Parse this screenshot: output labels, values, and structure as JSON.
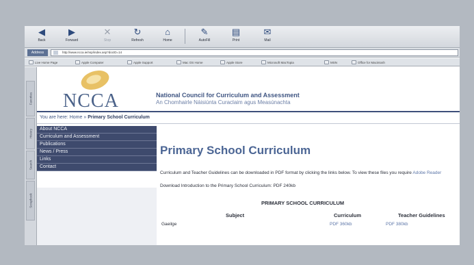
{
  "toolbar": {
    "buttons": [
      {
        "label": "Back",
        "icon": "back-arrow-icon",
        "glyph": "◀"
      },
      {
        "label": "Forward",
        "icon": "forward-arrow-icon",
        "glyph": "▶"
      },
      {
        "label": "Stop",
        "icon": "stop-icon",
        "glyph": "✕"
      },
      {
        "label": "Refresh",
        "icon": "refresh-icon",
        "glyph": "↻"
      },
      {
        "label": "Home",
        "icon": "home-icon",
        "glyph": "⌂"
      },
      {
        "label": "AutoFill",
        "icon": "autofill-icon",
        "glyph": "✎"
      },
      {
        "label": "Print",
        "icon": "print-icon",
        "glyph": "▤"
      },
      {
        "label": "Mail",
        "icon": "mail-icon",
        "glyph": "✉"
      }
    ]
  },
  "address_bar": {
    "label": "Address",
    "url": "http://www.ncca.ie/nsp/index.asp?docID=14"
  },
  "favorites": [
    "Live Home Page",
    "Apple Computer",
    "Apple Support",
    "Mac OS Home",
    "Apple Store",
    "Microsoft MacTopia",
    "MSN",
    "Office for Macintosh"
  ],
  "side_tabs": [
    "Favorites",
    "History",
    "Search",
    "Scrapbook"
  ],
  "page": {
    "logo_text": "NCCA",
    "org_name": "National Council for Curriculum and Assessment",
    "org_name_irish": "An Chomhairle Náisiúnta Curaclaim agus Measúnachta",
    "breadcrumb": {
      "prefix": "You are here: Home » ",
      "current": "Primary School Curriculum"
    },
    "nav": [
      "About NCCA",
      "Curriculum and Assessment",
      "Publications",
      "News / Press",
      "Links",
      "Contact"
    ],
    "title": "Primary School Curriculum",
    "intro_text": "Curriculum and Teacher Guidelines can be downloaded in PDF format by clicking the links below. To view these files you require ",
    "intro_link": "Adobe Reader",
    "download_text": "Download Introduction to the Primary School Curriculum: PDF 240kb",
    "table": {
      "title": "PRIMARY SCHOOL CURRICULUM",
      "col_subject": "Subject",
      "col_curriculum": "Curriculum",
      "col_guidelines": "Teacher Guidelines",
      "row1_subject": "Gaeilge",
      "row1_curriculum": "PDF 360kb",
      "row1_guidelines": "PDF 380kb"
    }
  }
}
